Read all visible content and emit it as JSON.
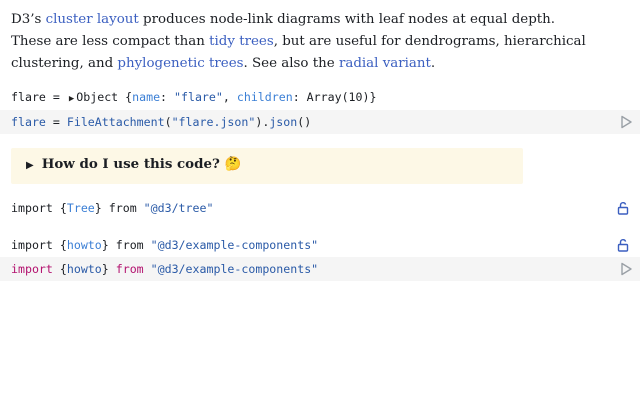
{
  "intro": {
    "p1": "D3’s ",
    "link_cluster": "cluster layout",
    "p2": " produces node-link diagrams with leaf nodes at equal depth.",
    "p3": "These are less compact than ",
    "link_tidy": "tidy trees",
    "p4": ", but are useful for dendrograms, hierarchical",
    "p5": "clustering, and ",
    "link_phylo": "phylogenetic trees",
    "p6": ". See also the ",
    "link_radial": "radial variant",
    "p7": "."
  },
  "output1": {
    "name": "flare",
    "eq": " = ",
    "obj": "Object {",
    "k1": "name",
    "colon": ": ",
    "v1": "\"flare\"",
    "sep": ", ",
    "k2": "children",
    "v2": "Array(10)",
    "close": "}"
  },
  "cell1": {
    "name": "flare",
    "eq": " = ",
    "fn": "FileAttachment",
    "p_open": "(",
    "arg": "\"flare.json\"",
    "p_mid": ").",
    "method": "json",
    "p_close": "()"
  },
  "callout": {
    "title": "How do I use this code? 🤔"
  },
  "import1": {
    "kw1": "import",
    "b_open": " {",
    "name": "Tree",
    "b_close": "} ",
    "kw2": "from",
    "sp": " ",
    "src": "\"@d3/tree\""
  },
  "import2": {
    "kw1": "import",
    "b_open": " {",
    "name": "howto",
    "b_close": "} ",
    "kw2": "from",
    "sp": " ",
    "src": "\"@d3/example-components\""
  },
  "cell2": {
    "kw1": "import",
    "b_open": " {",
    "name": "howto",
    "b_close": "} ",
    "kw2": "from",
    "sp": " ",
    "src": "\"@d3/example-components\""
  },
  "icons": {
    "run": "play-outline",
    "lock": "unlock-padlock",
    "disclosure": "triangle-right"
  },
  "colors": {
    "link": "#3b5fc0",
    "string": "#2a5aa7",
    "keyword": "#b3126f",
    "callout_bg": "#fdf8e6",
    "cell_bg": "#f5f5f5"
  }
}
